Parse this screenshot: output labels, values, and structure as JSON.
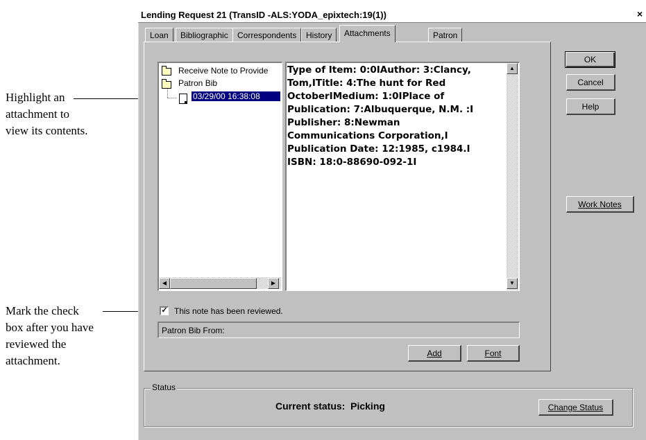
{
  "callouts": {
    "highlight": [
      "Highlight an",
      "attachment to",
      "view its contents."
    ],
    "mark": [
      "Mark the check",
      "box after you have",
      "reviewed the",
      "attachment."
    ]
  },
  "dialog": {
    "title": "Lending Request 21 (TransID -ALS:YODA_epixtech:19(1))",
    "close": "×"
  },
  "tabs": [
    "Loan",
    "Bibliographic",
    "Correspondents",
    "History",
    "Attachments",
    "Patron"
  ],
  "active_tab": "Attachments",
  "tree": {
    "items": [
      "Receive Note to Provide",
      "Patron Bib"
    ],
    "selected_child": "03/29/00 16:38:08"
  },
  "attachment_text": "Type of Item: 0:0IAuthor: 3:Clancy,\nTom,ITitle: 4:The hunt for Red\nOctoberIMedium: 1:0IPlace of\nPublication: 7:Albuquerque, N.M. :I\nPublisher: 8:Newman\nCommunications Corporation,I\nPublication Date: 12:1985, c1984.I\nISBN: 18:0-88690-092-1I",
  "checkbox": {
    "label": "This note has been reviewed.",
    "checked": true,
    "mark": "✓"
  },
  "note_field": {
    "value": "Patron Bib From:"
  },
  "buttons": {
    "add": "Add",
    "font": "Font",
    "ok": "OK",
    "cancel": "Cancel",
    "help": "Help",
    "work_notes": "Work Notes",
    "change_status": "Change Status"
  },
  "status": {
    "group_label": "Status",
    "text": "Current status:  Picking"
  },
  "scroll_arrows": {
    "up": "▲",
    "down": "▼",
    "left": "◀",
    "right": "▶"
  }
}
